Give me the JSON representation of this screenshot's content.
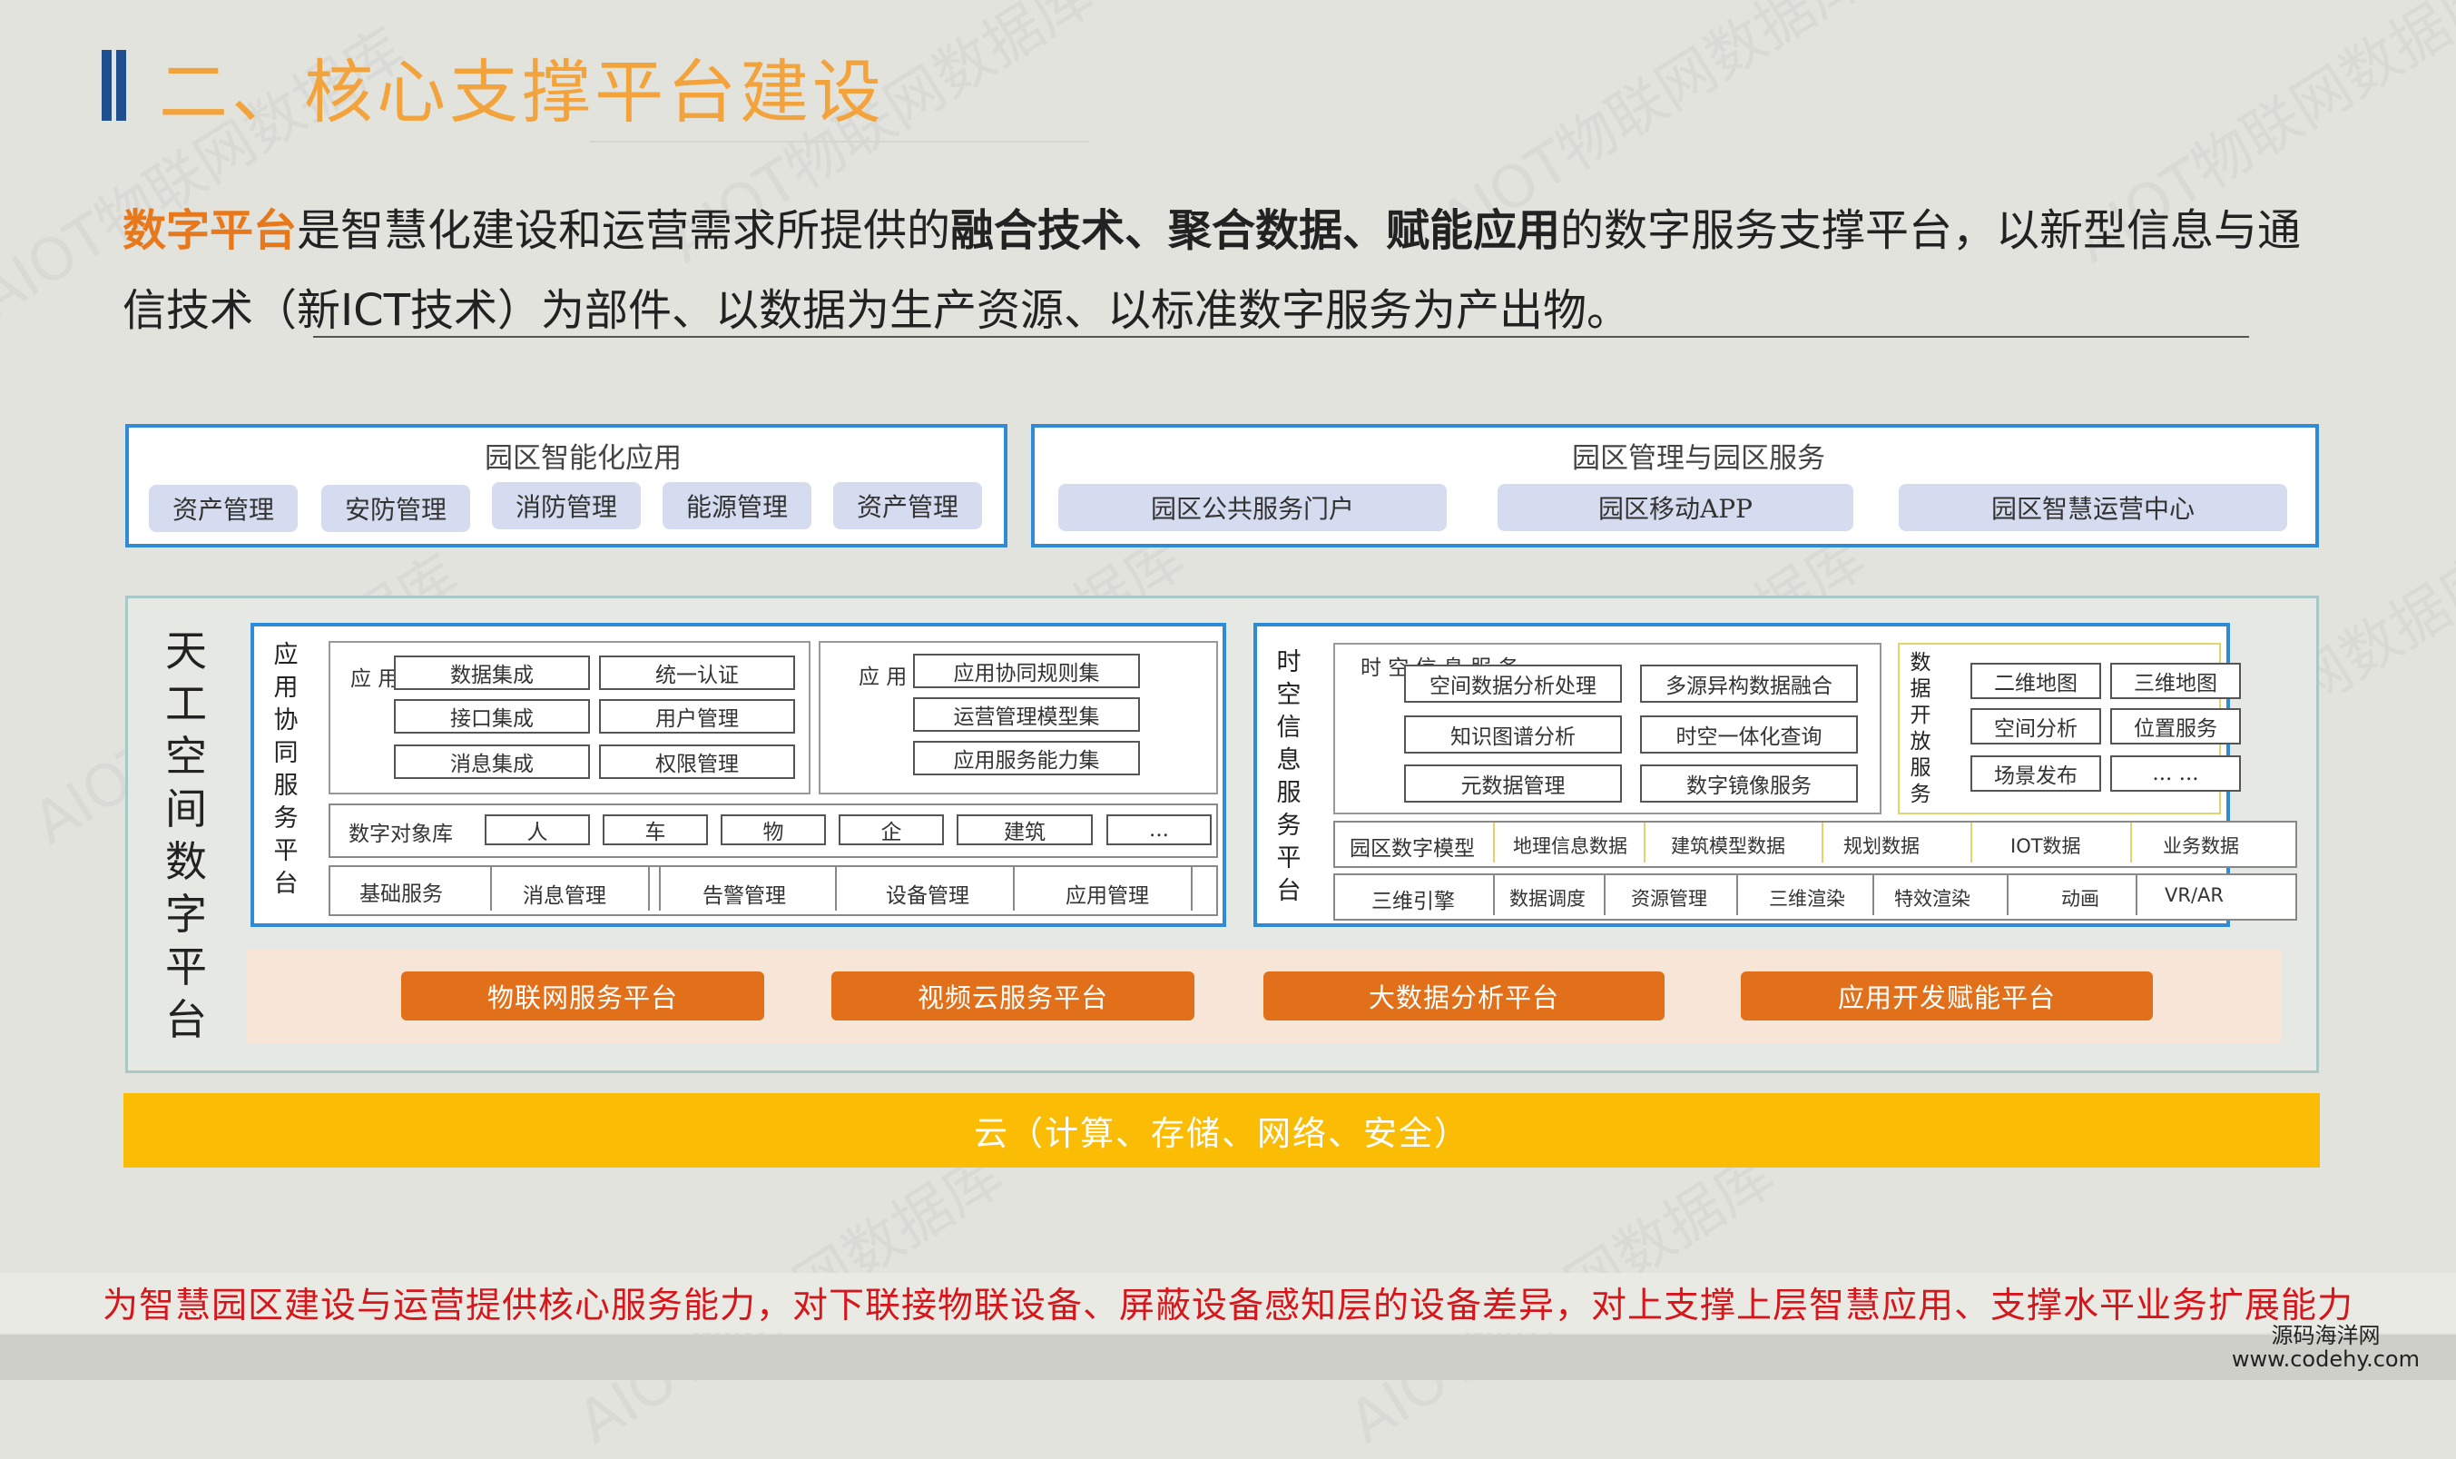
{
  "header": {
    "title": "二、核心支撑平台建设"
  },
  "intro": {
    "p1": "数字平台",
    "p2": "是智慧化建设和运营需求所提供的",
    "p3": "融合技术、聚合数据、赋能应用",
    "p4": "的数字服务支撑平台，以新型信息与通 信技术（新",
    "p5": "ICT",
    "p6": "技术）为部件、以数据为生产资源、以标准数字服务为产出物。"
  },
  "top_left": {
    "title": "园区智能化应用",
    "items": [
      "资产管理",
      "安防管理",
      "消防管理",
      "能源管理",
      "资产管理"
    ]
  },
  "top_right": {
    "title": "园区管理与园区服务",
    "items": [
      "园区公共服务门户",
      "园区移动APP",
      "园区智慧运营中心"
    ]
  },
  "platform": {
    "name_chars": [
      "天",
      "工",
      "空",
      "间",
      "数",
      "字",
      "平",
      "台"
    ],
    "app_collab": {
      "name_chars": [
        "应",
        "用",
        "协",
        "同",
        "服",
        "务",
        "平",
        "台"
      ],
      "group1_label": "应 用",
      "group1_items": [
        "数据集成",
        "统一认证",
        "接口集成",
        "用户管理",
        "消息集成",
        "权限管理"
      ],
      "group2_label": "应 用",
      "group2_items": [
        "应用协同规则集",
        "运营管理模型集",
        "应用服务能力集"
      ],
      "object_label": "数字对象库",
      "objects": [
        "人",
        "车",
        "物",
        "企",
        "建筑",
        "..."
      ],
      "base_label": "基础服务",
      "base_items": [
        "消息管理",
        "告警管理",
        "设备管理",
        "应用管理"
      ]
    },
    "spatial": {
      "name_chars": [
        "时",
        "空",
        "信",
        "息",
        "服",
        "务",
        "平",
        "台"
      ],
      "group_label": "时 空 信 息 服 务",
      "group_items": [
        "空间数据分析处理",
        "多源异构数据融合",
        "知识图谱分析",
        "时空一体化查询",
        "元数据管理",
        "数字镜像服务"
      ],
      "open_label_chars": [
        "数",
        "据",
        "开",
        "放",
        "服",
        "务"
      ],
      "open_items": [
        "二维地图",
        "三维地图",
        "空间分析",
        "位置服务",
        "场景发布",
        "... ..."
      ],
      "model_label": "园区数字模型",
      "model_items": [
        "地理信息数据",
        "建筑模型数据",
        "规划数据",
        "IOT数据",
        "业务数据"
      ],
      "engine_label": "三维引擎",
      "engine_items": [
        "数据调度",
        "资源管理",
        "三维渲染",
        "特效渲染",
        "动画",
        "VR/AR"
      ]
    },
    "services": [
      "物联网服务平台",
      "视频云服务平台",
      "大数据分析平台",
      "应用开发赋能平台"
    ]
  },
  "cloud": "云（计算、存储、网络、安全）",
  "footer": "为智慧园区建设与运营提供核心服务能力，对下联接物联设备、屏蔽设备感知层的设备差异，对上支撑上层智慧应用、支撑水平业务扩展能力",
  "corner": {
    "line1": "源码海洋网",
    "line2": "www.codehy.com"
  },
  "watermark": "AIOT物联网数据库",
  "colors": {
    "accent": "#f2a33c",
    "panel_border": "#2f8ad8",
    "service_orange": "#e2701a",
    "cloud_yellow": "#fbbc05",
    "footer_red": "#d7161b"
  }
}
